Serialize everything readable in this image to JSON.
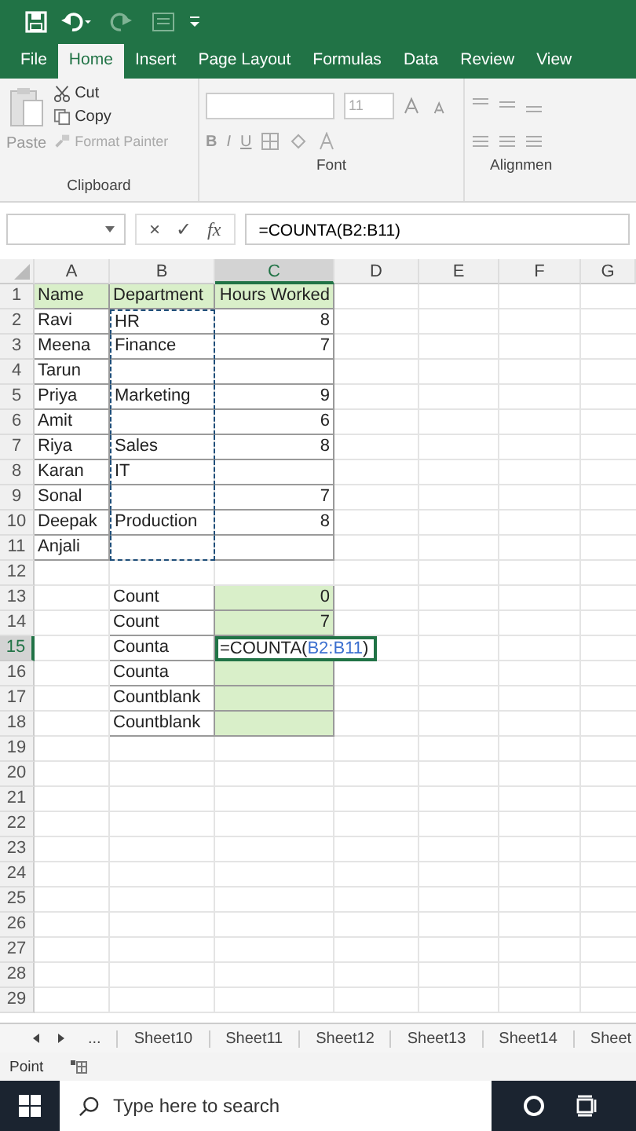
{
  "ribbon_tabs": [
    {
      "label": "File",
      "selected": false
    },
    {
      "label": "Home",
      "selected": true
    },
    {
      "label": "Insert",
      "selected": false
    },
    {
      "label": "Page Layout",
      "selected": false
    },
    {
      "label": "Formulas",
      "selected": false
    },
    {
      "label": "Data",
      "selected": false
    },
    {
      "label": "Review",
      "selected": false
    },
    {
      "label": "View",
      "selected": false
    }
  ],
  "clipboard": {
    "paste": "Paste",
    "cut": "Cut",
    "copy": "Copy",
    "format_painter": "Format Painter",
    "label": "Clipboard"
  },
  "font": {
    "size": "11",
    "bold": "B",
    "italic": "I",
    "underline": "U",
    "label": "Font"
  },
  "alignment": {
    "label": "Alignmen"
  },
  "formula_bar": {
    "cancel": "×",
    "enter": "✓",
    "function": "fx",
    "formula": "=COUNTA(B2:B11)"
  },
  "columns": [
    {
      "label": "A",
      "selected": false
    },
    {
      "label": "B",
      "selected": false
    },
    {
      "label": "C",
      "selected": true
    },
    {
      "label": "D",
      "selected": false
    },
    {
      "label": "E",
      "selected": false
    },
    {
      "label": "F",
      "selected": false
    },
    {
      "label": "G",
      "selected": false
    }
  ],
  "rows": [
    {
      "num": "1",
      "kind": "header",
      "a": "Name",
      "b": "Department",
      "c": "Hours Worked"
    },
    {
      "num": "2",
      "kind": "record",
      "a": "Ravi",
      "b": "HR",
      "c": "8",
      "in_range": true
    },
    {
      "num": "3",
      "kind": "record",
      "a": "Meena",
      "b": "Finance",
      "c": "7",
      "in_range": true
    },
    {
      "num": "4",
      "kind": "record",
      "a": "Tarun",
      "in_range": true
    },
    {
      "num": "5",
      "kind": "record",
      "a": "Priya",
      "b": "Marketing",
      "c": "9",
      "in_range": true
    },
    {
      "num": "6",
      "kind": "record",
      "a": "Amit",
      "c": "6",
      "in_range": true
    },
    {
      "num": "7",
      "kind": "record",
      "a": "Riya",
      "b": "Sales",
      "c": "8",
      "in_range": true
    },
    {
      "num": "8",
      "kind": "record",
      "a": "Karan",
      "b": "IT",
      "in_range": true
    },
    {
      "num": "9",
      "kind": "record",
      "a": "Sonal",
      "c": "7",
      "in_range": true
    },
    {
      "num": "10",
      "kind": "record",
      "a": "Deepak",
      "b": "Production",
      "c": "8",
      "in_range": true
    },
    {
      "num": "11",
      "kind": "record",
      "a": "Anjali",
      "in_range": true
    },
    {
      "num": "12",
      "kind": "blank"
    },
    {
      "num": "13",
      "kind": "summary",
      "b": "Count",
      "c": "0"
    },
    {
      "num": "14",
      "kind": "summary",
      "b": "Count",
      "c": "7"
    },
    {
      "num": "15",
      "kind": "summary",
      "b": "Counta",
      "editing": {
        "before": "=COUNTA(",
        "ref": "B2:B11",
        "after": ")"
      },
      "selected": true
    },
    {
      "num": "16",
      "kind": "summary",
      "b": "Counta"
    },
    {
      "num": "17",
      "kind": "summary",
      "b": "Countblank"
    },
    {
      "num": "18",
      "kind": "summary",
      "b": "Countblank"
    },
    {
      "num": "19",
      "kind": "blank"
    },
    {
      "num": "20",
      "kind": "blank"
    },
    {
      "num": "21",
      "kind": "blank"
    },
    {
      "num": "22",
      "kind": "blank"
    },
    {
      "num": "23",
      "kind": "blank"
    },
    {
      "num": "24",
      "kind": "blank"
    },
    {
      "num": "25",
      "kind": "blank"
    },
    {
      "num": "26",
      "kind": "blank"
    },
    {
      "num": "27",
      "kind": "blank"
    },
    {
      "num": "28",
      "kind": "blank"
    },
    {
      "num": "29",
      "kind": "blank"
    }
  ],
  "sheet_tabs": {
    "more": "...",
    "tabs": [
      "Sheet10",
      "Sheet11",
      "Sheet12",
      "Sheet13",
      "Sheet14",
      "Sheet"
    ]
  },
  "status_bar": {
    "mode": "Point"
  },
  "taskbar": {
    "search_placeholder": "Type here to search"
  }
}
